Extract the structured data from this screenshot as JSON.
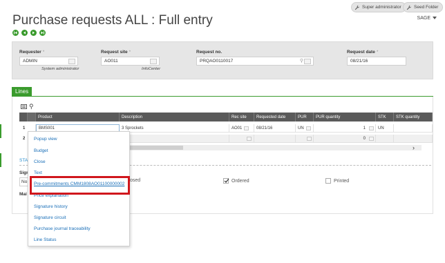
{
  "topbar": {
    "user_role": "Super administrator",
    "folder": "Seed Folder",
    "company": "SAGE"
  },
  "page": {
    "title": "Purchase requests ALL : Full entry"
  },
  "header": {
    "requester": {
      "label": "Requester",
      "value": "ADMIN",
      "sub": "System administrator"
    },
    "request_site": {
      "label": "Request site",
      "value": "AO011",
      "sub": "InfoCenter"
    },
    "request_no": {
      "label": "Request no.",
      "value": "PRQAO0110017"
    },
    "request_date": {
      "label": "Request date",
      "value": "08/21/16"
    }
  },
  "lines": {
    "tab_label": "Lines",
    "columns": [
      "Product",
      "Description",
      "Rec site",
      "Requested date",
      "PUR",
      "PUR quantity",
      "STK",
      "STK quantity"
    ],
    "rows": [
      {
        "num": "1",
        "product": "BMS001",
        "description": "3 Sprockets",
        "rec_site": "AO01",
        "requested_date": "08/21/16",
        "pur": "UN",
        "pur_quantity": "1",
        "stk": "UN",
        "stk_quantity": ""
      },
      {
        "num": "2",
        "product": "",
        "description": "",
        "rec_site": "",
        "requested_date": "",
        "pur": "",
        "pur_quantity": "0",
        "stk": "",
        "stk_quantity": ""
      }
    ]
  },
  "status": {
    "section_label": "STA",
    "signature_label": "Sign",
    "signature_value": "No",
    "main_label": "Mai",
    "closed_label": "osed",
    "ordered_label": "Ordered",
    "printed_label": "Printed"
  },
  "context_menu": {
    "items": [
      "Popup view",
      "Budget",
      "Close",
      "Text",
      "Pre-commitments CMM1808AO01100000002",
      "Price explanation",
      "Signature history",
      "Signature circuit",
      "Purchase journal traceability",
      "Line Status"
    ]
  },
  "colors": {
    "accent_green": "#3a9b2d",
    "link_blue": "#1a6fb8",
    "highlight_red": "#d0161c",
    "grid_header": "#5a5a5a"
  }
}
